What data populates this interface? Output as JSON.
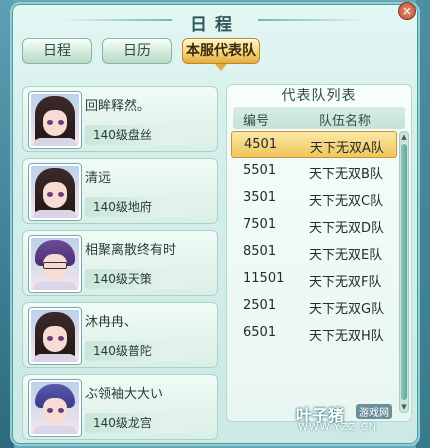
{
  "window": {
    "title": "日程",
    "close_glyph": "×"
  },
  "tabs": [
    {
      "label": "日程",
      "active": false
    },
    {
      "label": "日历",
      "active": false
    },
    {
      "label": "本服代表队",
      "active": true
    }
  ],
  "members": [
    {
      "name": "回眸释然。",
      "level": "140级盘丝"
    },
    {
      "name": "清远",
      "level": "140级地府"
    },
    {
      "name": "相聚离散终有时",
      "level": "140级天策"
    },
    {
      "name": "沐冉冉、",
      "level": "140级普陀"
    },
    {
      "name": "ぶ领袖大大い",
      "level": "140级龙宫"
    }
  ],
  "team_list": {
    "title": "代表队列表",
    "col_num": "编号",
    "col_team": "队伍名称",
    "rows": [
      {
        "num": "4501",
        "team": "天下无双A队",
        "selected": true
      },
      {
        "num": "5501",
        "team": "天下无双B队",
        "selected": false
      },
      {
        "num": "3501",
        "team": "天下无双C队",
        "selected": false
      },
      {
        "num": "7501",
        "team": "天下无双D队",
        "selected": false
      },
      {
        "num": "8501",
        "team": "天下无双E队",
        "selected": false
      },
      {
        "num": "11501",
        "team": "天下无双F队",
        "selected": false
      },
      {
        "num": "2501",
        "team": "天下无双G队",
        "selected": false
      },
      {
        "num": "6501",
        "team": "天下无双H队",
        "selected": false
      }
    ]
  },
  "watermark": {
    "main": "叶子猪",
    "badge": "游戏网",
    "url": "WWW.YZZ.CN"
  },
  "colors": {
    "accent": "#f0c65c",
    "panel": "#d4efeb",
    "border": "#8ed0cf"
  }
}
